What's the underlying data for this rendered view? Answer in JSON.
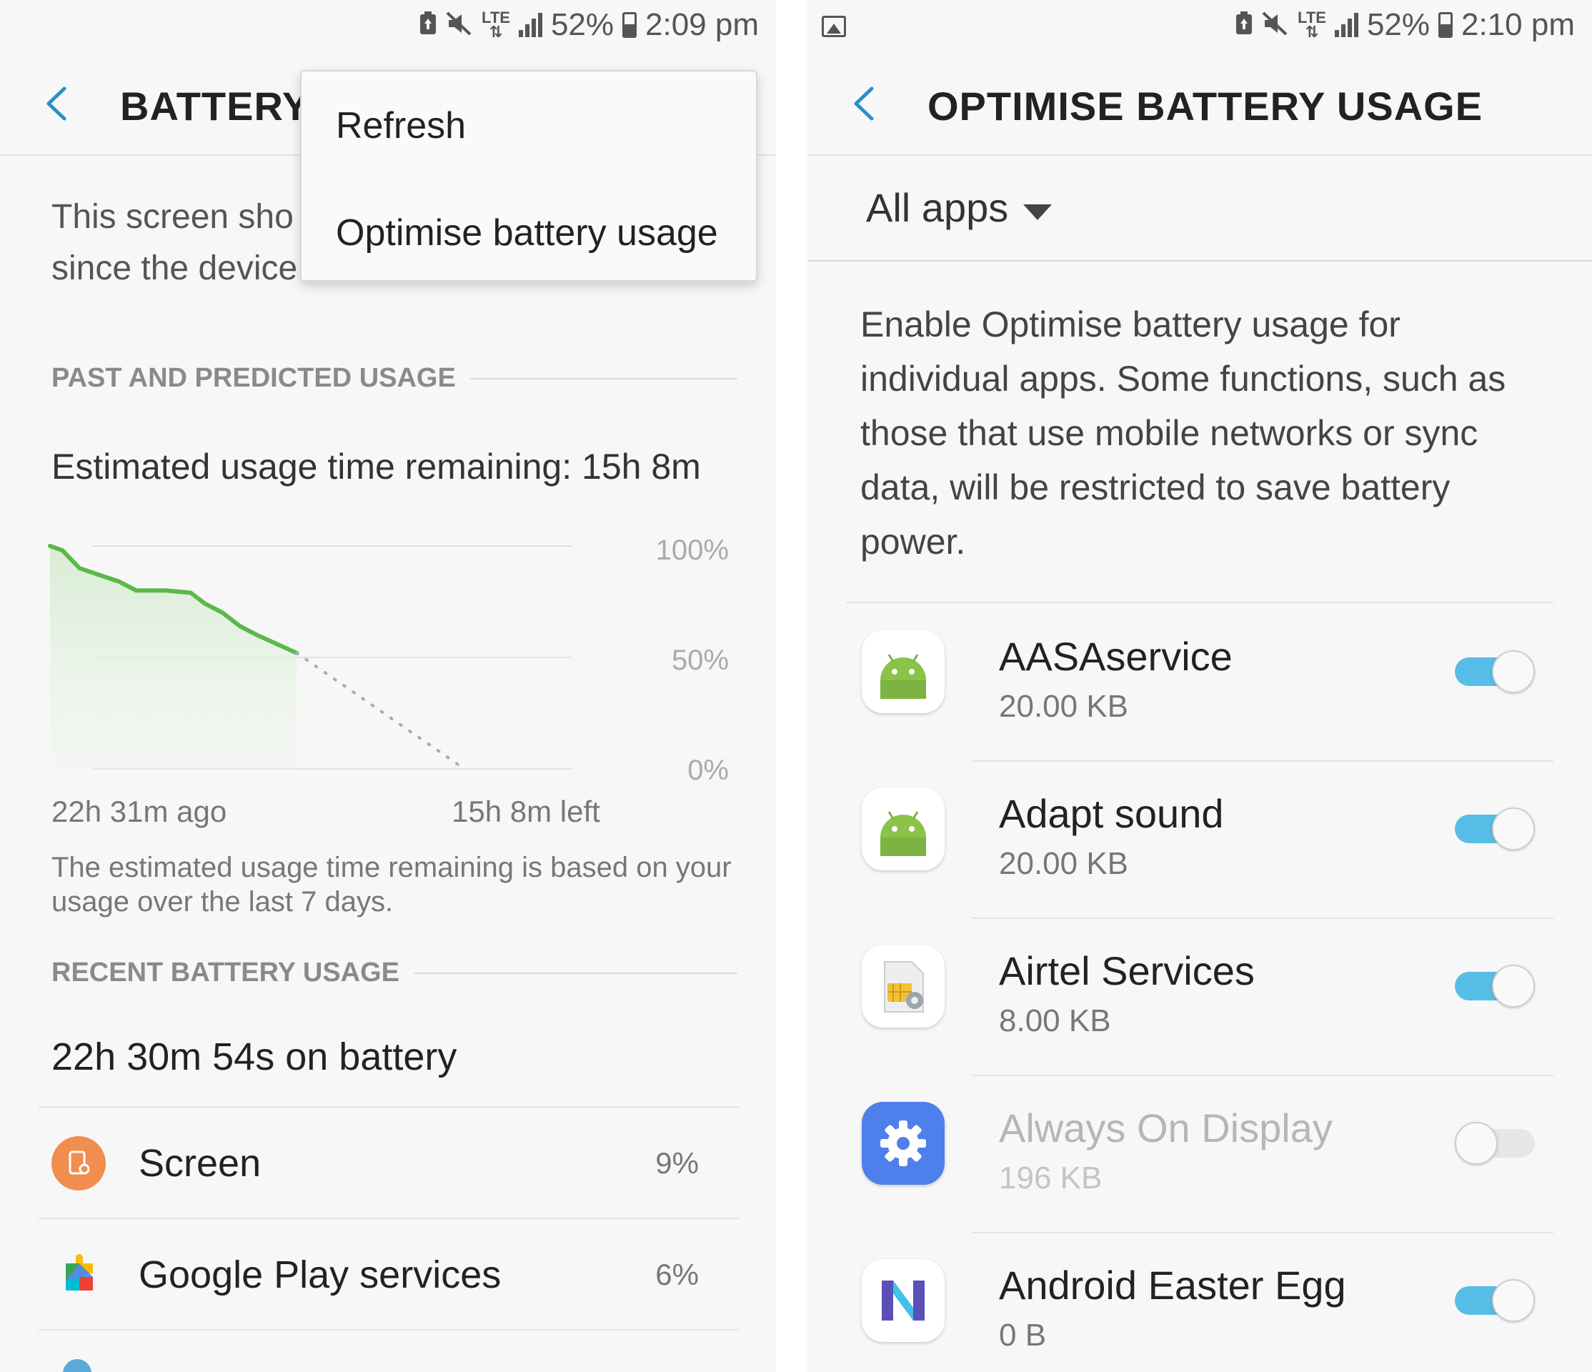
{
  "left": {
    "status": {
      "battery": "52%",
      "time": "2:09 pm",
      "network": "LTE"
    },
    "header": {
      "title": "BATTERY U"
    },
    "menu": {
      "items": [
        "Refresh",
        "Optimise battery usage"
      ]
    },
    "intro": {
      "line1": "This screen sho",
      "line2": "since the device"
    },
    "past_section": {
      "title": "PAST AND PREDICTED USAGE"
    },
    "estimate": "Estimated usage time remaining: 15h 8m",
    "chart_data": {
      "type": "line",
      "title": "",
      "xlabel": "",
      "ylabel": "",
      "ylim": [
        0,
        100
      ],
      "y_ticks": [
        "100%",
        "50%",
        "0%"
      ],
      "x_labels": [
        "22h 31m ago",
        "15h 8m left"
      ],
      "series": [
        {
          "style": "solid",
          "color": "#5cb84a",
          "values": [
            [
              0,
              100
            ],
            [
              0.05,
              98
            ],
            [
              0.12,
              90
            ],
            [
              0.2,
              87
            ],
            [
              0.28,
              84
            ],
            [
              0.35,
              80
            ],
            [
              0.47,
              80
            ],
            [
              0.57,
              79
            ],
            [
              0.63,
              74
            ],
            [
              0.7,
              70
            ],
            [
              0.77,
              64
            ],
            [
              0.84,
              60
            ],
            [
              1.0,
              52
            ]
          ]
        },
        {
          "style": "dotted",
          "color": "#9bb0b8",
          "values": [
            [
              1.0,
              52
            ],
            [
              1.68,
              0
            ]
          ]
        }
      ]
    },
    "chart_note": "The estimated usage time remaining is based on your usage over the last 7 days.",
    "recent_section": {
      "title": "RECENT BATTERY USAGE"
    },
    "on_battery": "22h 30m 54s on battery",
    "usage_items": [
      {
        "label": "Screen",
        "pct": "9%",
        "icon": "screen-icon",
        "color": "#f08d4f"
      },
      {
        "label": "Google Play services",
        "pct": "6%",
        "icon": "google-play-services-icon",
        "color": "#4285f4"
      }
    ]
  },
  "right": {
    "status": {
      "battery": "52%",
      "time": "2:10 pm",
      "network": "LTE"
    },
    "header": {
      "title": "OPTIMISE BATTERY USAGE"
    },
    "filter": {
      "label": "All apps"
    },
    "description": "Enable Optimise battery usage for individual apps. Some functions, such as those that use mobile networks or sync data, will be restricted to save battery power.",
    "apps": [
      {
        "name": "AASAservice",
        "size": "20.00 KB",
        "enabled": true,
        "icon": "android-icon"
      },
      {
        "name": "Adapt sound",
        "size": "20.00 KB",
        "enabled": true,
        "icon": "android-icon"
      },
      {
        "name": "Airtel Services",
        "size": "8.00 KB",
        "enabled": true,
        "icon": "sim-toolkit-icon"
      },
      {
        "name": "Always On Display",
        "size": "196 KB",
        "enabled": false,
        "icon": "gear-icon"
      },
      {
        "name": "Android Easter Egg",
        "size": "0 B",
        "enabled": true,
        "icon": "android-n-icon"
      }
    ]
  }
}
